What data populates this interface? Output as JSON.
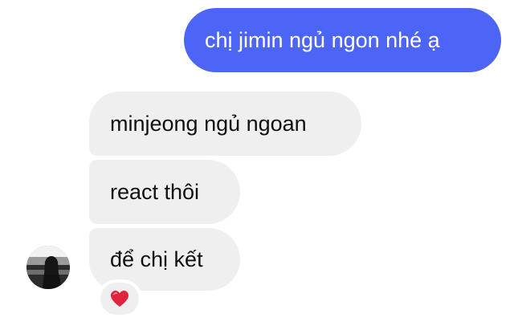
{
  "conversation": {
    "sent_message": "chị jimin ngủ ngon nhé ạ",
    "received_messages": [
      "minjeong ngủ ngoan",
      "react thôi",
      "để chị kết"
    ],
    "reaction": {
      "icon": "heart-icon",
      "color": "#e0243b"
    },
    "avatar": {
      "icon": "profile-photo"
    },
    "colors": {
      "sent_bubble": "#4d65f6",
      "received_bubble": "#efefef"
    }
  }
}
